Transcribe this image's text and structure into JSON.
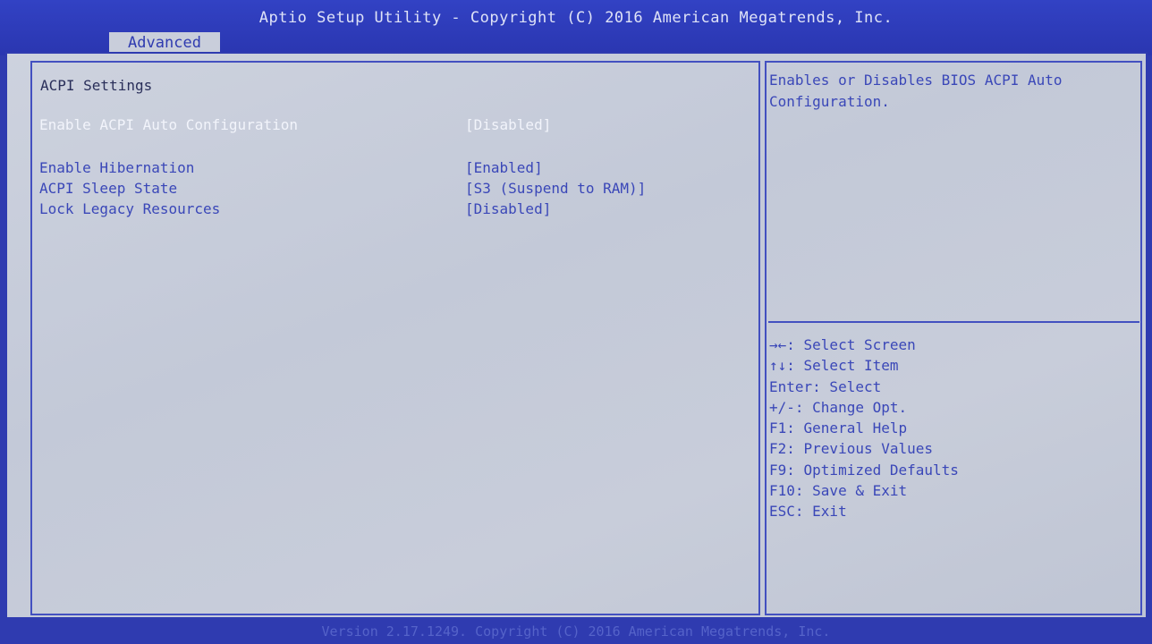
{
  "header": {
    "title": "Aptio Setup Utility - Copyright (C) 2016 American Megatrends, Inc.",
    "active_tab": "Advanced"
  },
  "main": {
    "section_title": "ACPI Settings",
    "settings": [
      {
        "label": "Enable ACPI Auto Configuration",
        "value": "[Disabled]",
        "selected": true
      },
      {
        "label": "Enable Hibernation",
        "value": "[Enabled]",
        "selected": false
      },
      {
        "label": "ACPI Sleep State",
        "value": "[S3 (Suspend to RAM)]",
        "selected": false
      },
      {
        "label": "Lock Legacy Resources",
        "value": "[Disabled]",
        "selected": false
      }
    ]
  },
  "help": {
    "description": "Enables or Disables BIOS ACPI Auto Configuration.",
    "keys": [
      "→←: Select Screen",
      "↑↓: Select Item",
      "Enter: Select",
      "+/-: Change Opt.",
      "F1: General Help",
      "F2: Previous Values",
      "F9: Optimized Defaults",
      "F10: Save & Exit",
      "ESC: Exit"
    ]
  },
  "footer": {
    "text": "Version 2.17.1249. Copyright (C) 2016 American Megatrends, Inc."
  },
  "colors": {
    "background_blue": "#2f3bb0",
    "panel_gray": "#c6cbd8",
    "text_blue": "#3a47b8",
    "selected_text": "#f2f4fb"
  }
}
